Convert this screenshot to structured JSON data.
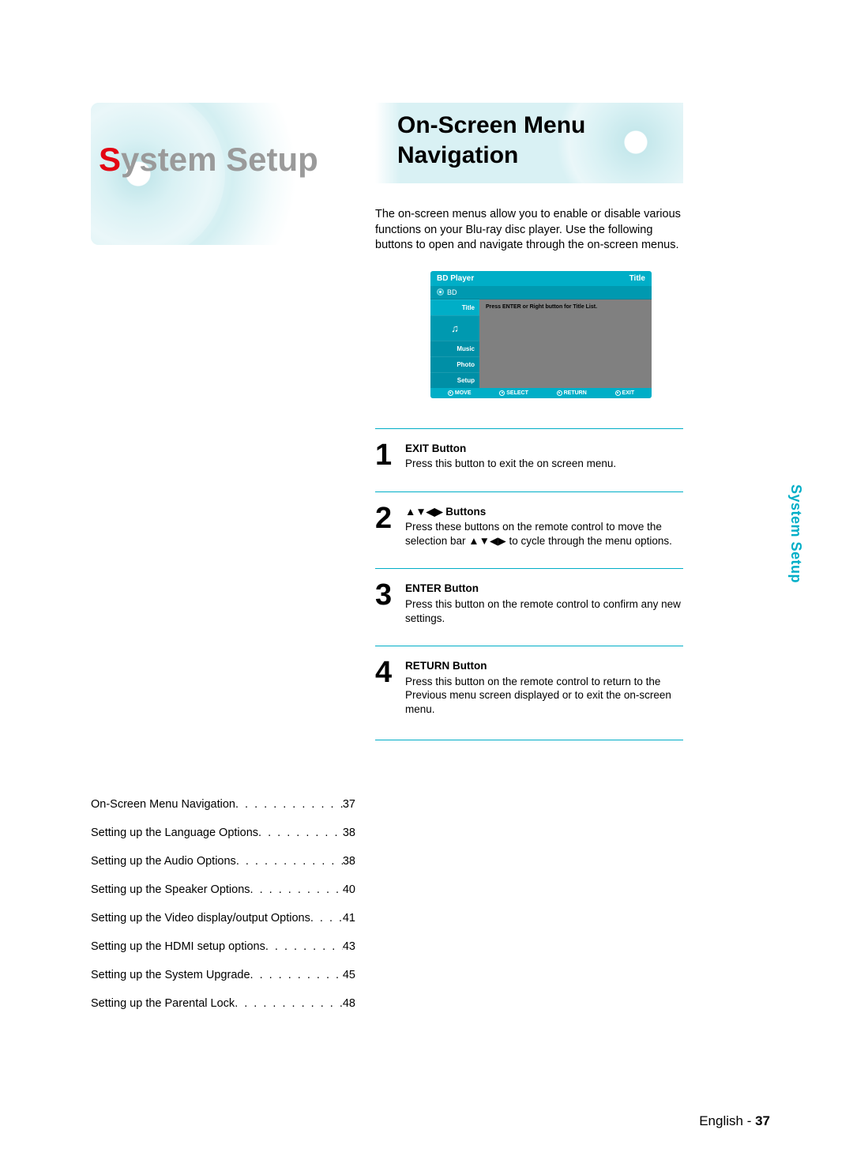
{
  "left": {
    "title_part1": "S",
    "title_part2": "ystem Setup"
  },
  "toc": [
    {
      "label": "On-Screen Menu Navigation",
      "page": "37"
    },
    {
      "label": "Setting up the Language Options",
      "page": "38"
    },
    {
      "label": "Setting up the Audio Options",
      "page": "38"
    },
    {
      "label": "Setting up the Speaker Options",
      "page": "40"
    },
    {
      "label": "Setting up the Video display/output Options",
      "page": "41"
    },
    {
      "label": "Setting up the HDMI setup options",
      "page": "43"
    },
    {
      "label": "Setting up the System Upgrade",
      "page": "45"
    },
    {
      "label": "Setting up the Parental Lock",
      "page": "48"
    }
  ],
  "right": {
    "title_line1": "On-Screen Menu",
    "title_line2": "Navigation",
    "intro": "The on-screen menus allow you to enable or disable various functions on your Blu-ray disc player. Use the following buttons to open and navigate through the on-screen menus."
  },
  "screen": {
    "top_left": "BD Player",
    "top_right": "Title",
    "sub": "BD",
    "side": [
      "Title",
      "Music",
      "Photo",
      "Setup"
    ],
    "content_hint": "Press ENTER or Right button for Title List.",
    "bottom": {
      "move": "MOVE",
      "select": "SELECT",
      "return": "RETURN",
      "exit": "EXIT"
    }
  },
  "steps": [
    {
      "num": "1",
      "title": "EXIT Button",
      "desc": "Press this button to exit the on screen menu."
    },
    {
      "num": "2",
      "title_prefix_arrows": "▲▼◀▶",
      "title": " Buttons",
      "desc_part1": "Press these buttons on the remote control to move the selection bar ",
      "desc_arrows": "▲▼◀▶",
      "desc_part2": " to cycle through the menu options."
    },
    {
      "num": "3",
      "title": "ENTER Button",
      "desc": "Press this button on the remote control to confirm any new settings."
    },
    {
      "num": "4",
      "title": "RETURN Button",
      "desc": "Press this button on the remote control to return to the Previous menu screen displayed or to exit the on-screen menu."
    }
  ],
  "side_tab": "System Setup",
  "footer": {
    "lang": "English",
    "sep": " - ",
    "page": "37"
  }
}
